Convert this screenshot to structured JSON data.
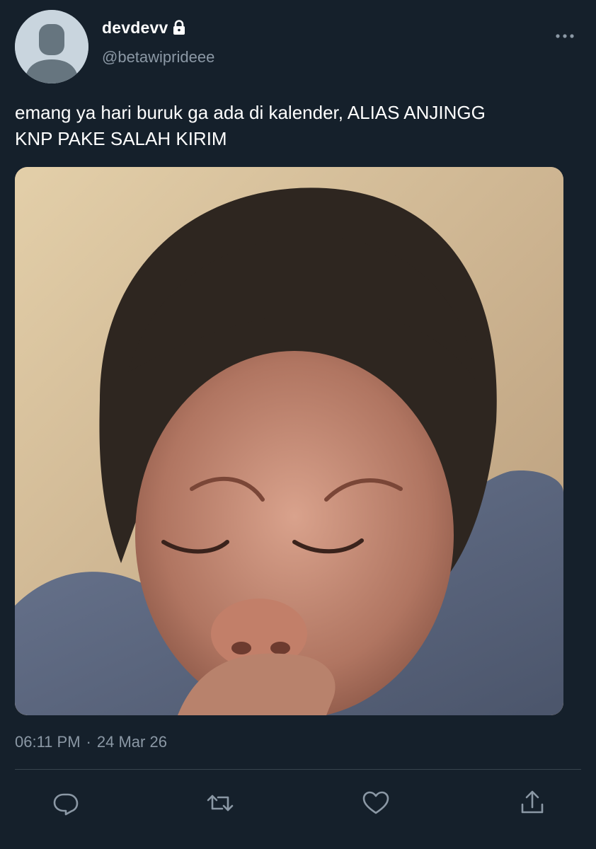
{
  "colors": {
    "background": "#15202b",
    "text_primary": "#ffffff",
    "text_secondary": "#8b98a5",
    "divider": "#38444d"
  },
  "author": {
    "display_name": "devdevv",
    "handle": "@betawiprideee",
    "protected_icon": "lock-icon",
    "avatar_icon": "default-avatar-icon"
  },
  "tweet": {
    "text": "emang ya hari buruk ga ada di kalender, ALIAS ANJINGG\nKNP PAKE SALAH KIRIM",
    "media_alt": "photo",
    "time": "06:11 PM",
    "separator": "·",
    "date": "24 Mar 26"
  },
  "actions": {
    "reply_icon": "reply-icon",
    "retweet_icon": "retweet-icon",
    "like_icon": "heart-icon",
    "share_icon": "share-icon",
    "more_icon": "more-options-icon"
  }
}
